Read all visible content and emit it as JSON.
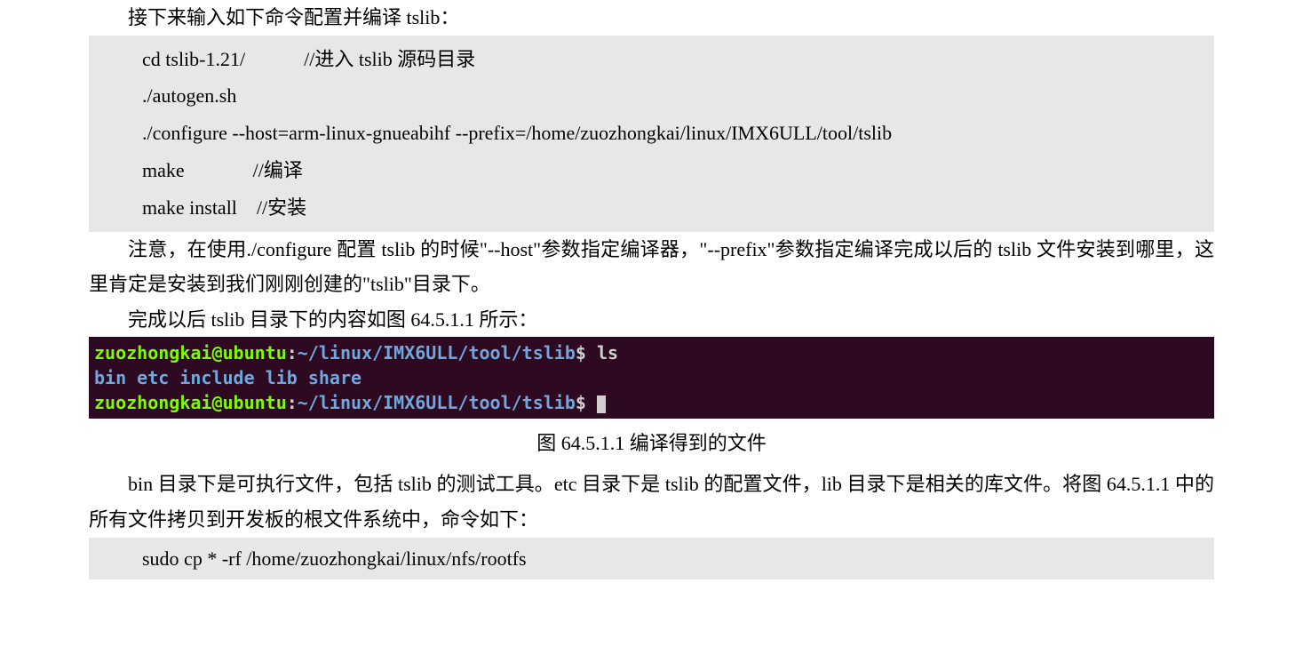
{
  "intro": "接下来输入如下命令配置并编译 tslib：",
  "code": {
    "l1": "cd tslib-1.21/            //进入 tslib 源码目录",
    "l2": "./autogen.sh",
    "l3": "./configure --host=arm-linux-gnueabihf --prefix=/home/zuozhongkai/linux/IMX6ULL/tool/tslib",
    "l4": "make              //编译",
    "l5": "make install    //安装"
  },
  "para2a": "注意，在使用./configure 配置 tslib 的时候\"--host\"参数指定编译器，\"--prefix\"参数指定编译完成以后的 tslib 文件安装到哪里，这里肯定是安装到我们刚刚创建的\"tslib\"目录下。",
  "para2b": "完成以后 tslib 目录下的内容如图 64.5.1.1 所示：",
  "terminal": {
    "user1": "zuozhongkai@ubuntu",
    "colon1": ":",
    "path1": "~/linux/IMX6ULL/tool/tslib",
    "dollar1": "$ ",
    "cmd1": "ls",
    "out": "bin  etc  include  lib  share",
    "user2": "zuozhongkai@ubuntu",
    "colon2": ":",
    "path2": "~/linux/IMX6ULL/tool/tslib",
    "dollar2": "$ "
  },
  "caption": "图 64.5.1.1  编译得到的文件",
  "para3": "bin 目录下是可执行文件，包括 tslib 的测试工具。etc 目录下是 tslib 的配置文件，lib 目录下是相关的库文件。将图 64.5.1.1 中的所有文件拷贝到开发板的根文件系统中，命令如下：",
  "code2": "sudo cp * -rf /home/zuozhongkai/linux/nfs/rootfs"
}
